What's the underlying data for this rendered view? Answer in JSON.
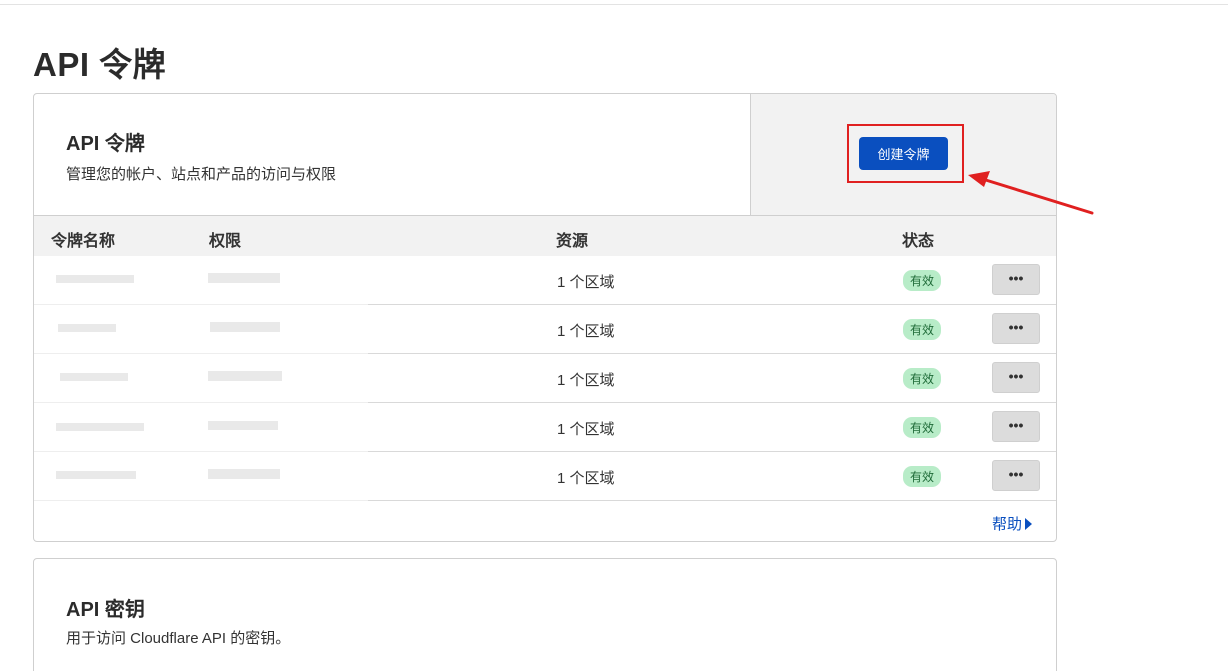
{
  "page": {
    "title": "API 令牌"
  },
  "tokens_card": {
    "title": "API 令牌",
    "description": "管理您的帐户、站点和产品的访问与权限",
    "create_button": "创建令牌",
    "columns": [
      "令牌名称",
      "权限",
      "资源",
      "状态"
    ],
    "rows": [
      {
        "resource": "1 个区域",
        "status": "有效",
        "more": "•••"
      },
      {
        "resource": "1 个区域",
        "status": "有效",
        "more": "•••"
      },
      {
        "resource": "1 个区域",
        "status": "有效",
        "more": "•••"
      },
      {
        "resource": "1 个区域",
        "status": "有效",
        "more": "•••"
      },
      {
        "resource": "1 个区域",
        "status": "有效",
        "more": "•••"
      }
    ],
    "help_link": "帮助"
  },
  "keys_card": {
    "title": "API 密钥",
    "description": "用于访问 Cloudflare API 的密钥。"
  },
  "colors": {
    "accent": "#0a4fbf",
    "annotation": "#e02020",
    "badge_bg": "#b8ecc8"
  },
  "icons": {
    "more": "ellipsis-icon",
    "help": "caret-right-icon",
    "annotation": "red-arrow-icon"
  }
}
